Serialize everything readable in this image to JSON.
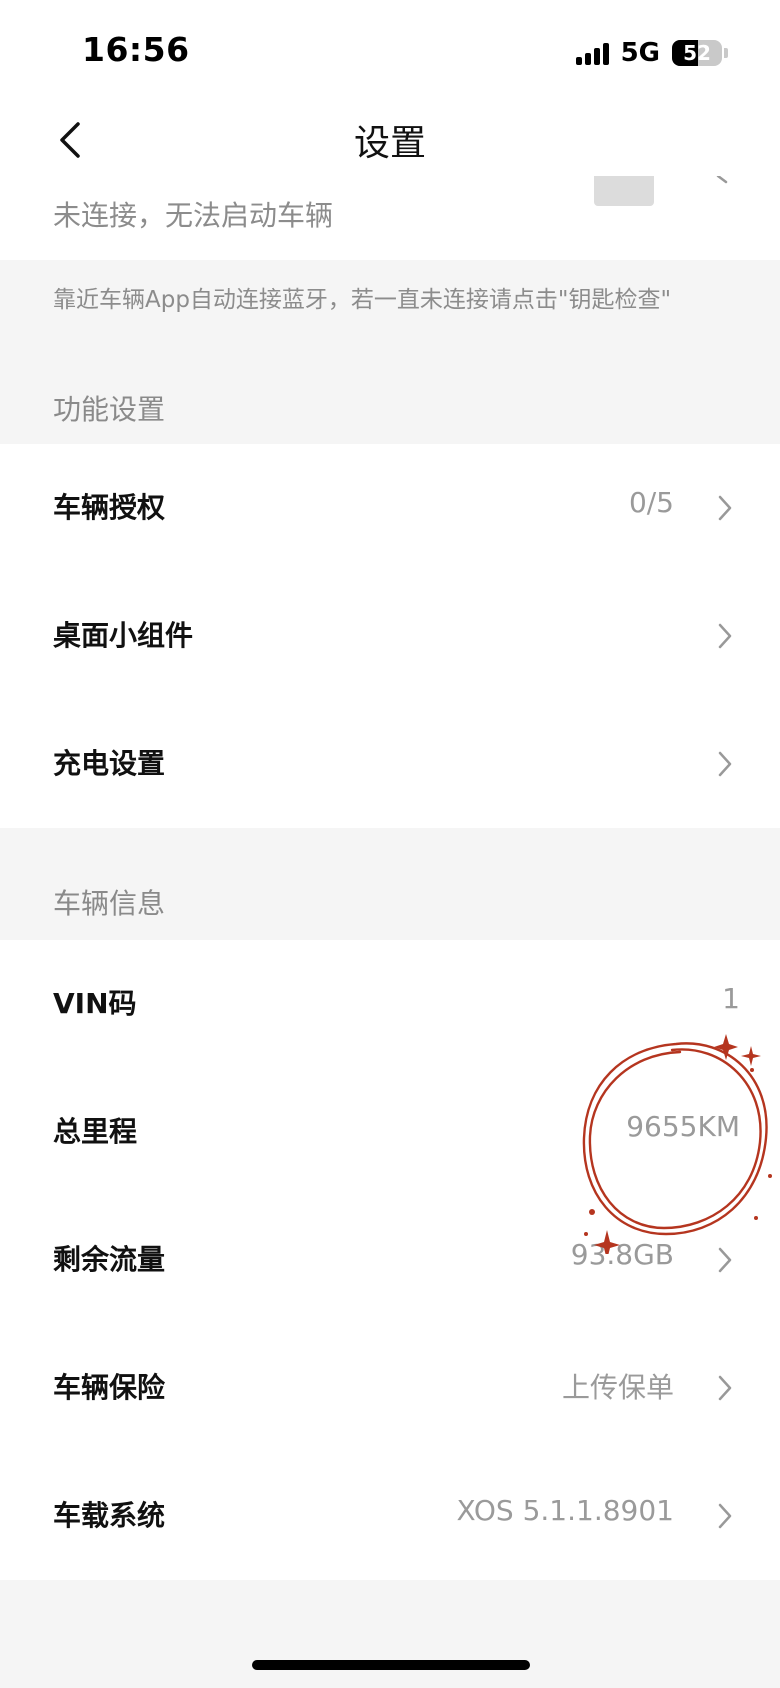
{
  "status_bar": {
    "time": "16:56",
    "network": "5G",
    "battery": "52",
    "battery_level": 0.52
  },
  "nav": {
    "title": "设置",
    "back_icon": "chevron-left-icon"
  },
  "key_card": {
    "status_text": "未连接，无法启动车辆"
  },
  "hint": "靠近车辆App自动连接蓝牙，若一直未连接请点击\"钥匙检查\"",
  "sections": {
    "function_settings": {
      "header": "功能设置",
      "items": [
        {
          "label": "车辆授权",
          "value": "0/5"
        },
        {
          "label": "桌面小组件",
          "value": ""
        },
        {
          "label": "充电设置",
          "value": ""
        }
      ]
    },
    "vehicle_info": {
      "header": "车辆信息",
      "items": [
        {
          "label": "VIN码",
          "value": "1"
        },
        {
          "label": "总里程",
          "value": "9655KM"
        },
        {
          "label": "剩余流量",
          "value": "93.8GB"
        },
        {
          "label": "车辆保险",
          "value": "上传保单"
        },
        {
          "label": "车载系统",
          "value": "XOS 5.1.1.8901"
        }
      ]
    }
  },
  "colors": {
    "doodle": "#b5351f",
    "background": "#f5f5f5",
    "card": "#ffffff"
  }
}
